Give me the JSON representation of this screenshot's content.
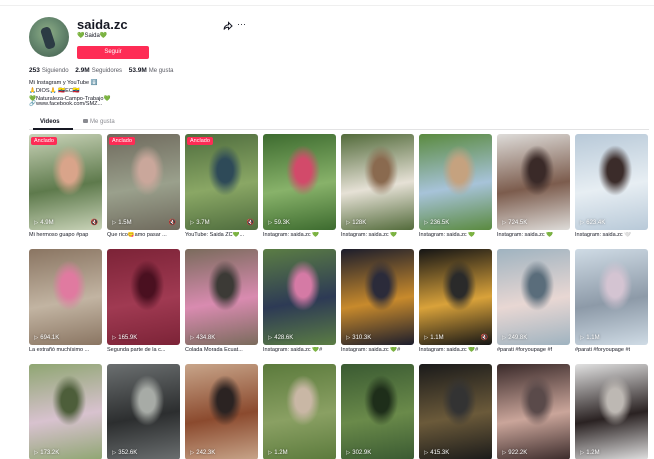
{
  "profile": {
    "username": "saida.zc",
    "nickname": "💚Saida💚",
    "follow_label": "Seguir",
    "share_icon": "share-icon",
    "more_label": "···"
  },
  "stats": {
    "following_count": "253",
    "following_label": "Siguiendo",
    "followers_count": "2.9M",
    "followers_label": "Seguidores",
    "likes_count": "53.9M",
    "likes_label": "Me gusta"
  },
  "bio": {
    "line1": "Mi Instagram y YouTube ⬇️",
    "line2": "🙏DIOS🙏 🇪🇨EC🇪🇨",
    "line3": "💚Naturaleza-Campo-Trabajo💚",
    "link": "www.facebook.com/SMZ..."
  },
  "tabs": {
    "videos": "Videos",
    "likes": "Me gusta"
  },
  "videos": [
    {
      "views": "4.9M",
      "caption": "Mi hermoso guapo #pap",
      "pinned": "Anclado",
      "muted": "🔇",
      "colors": [
        "#c9d3b8",
        "#5e7a4c",
        "#d9a48a"
      ]
    },
    {
      "views": "1.5M",
      "caption": "Que rico😋amo pasar ...",
      "pinned": "Anclado",
      "muted": "🔇",
      "colors": [
        "#6f6a5d",
        "#9aa08c",
        "#caa79b"
      ]
    },
    {
      "views": "3.7M",
      "caption": "YouTube: Saida ZC💚...",
      "pinned": "Anclado",
      "muted": "🔇",
      "colors": [
        "#4f6d3e",
        "#8aa765",
        "#2e4a58"
      ]
    },
    {
      "views": "59.3K",
      "caption": "Instagram: saida.zc 💚",
      "pinned": "",
      "muted": "",
      "colors": [
        "#3d6b2f",
        "#88b26a",
        "#d24a6a"
      ]
    },
    {
      "views": "128K",
      "caption": "Instagram: saida.zc 💚",
      "pinned": "",
      "muted": "",
      "colors": [
        "#536b3b",
        "#e6e1d6",
        "#8a6a4f"
      ]
    },
    {
      "views": "236.5K",
      "caption": "Instagram: saida.zc 💚",
      "pinned": "",
      "muted": "",
      "colors": [
        "#5a8a3f",
        "#a7c3d9",
        "#c5a27f"
      ]
    },
    {
      "views": "724.5K",
      "caption": "Instagram: saida.zc 💚",
      "pinned": "",
      "muted": "",
      "colors": [
        "#dedcd9",
        "#7c5c4d",
        "#3a2a28"
      ]
    },
    {
      "views": "623.4K",
      "caption": "Instagram: saida.zc 🤍",
      "pinned": "",
      "muted": "",
      "colors": [
        "#b8c9d8",
        "#e7eef3",
        "#3b2c2a"
      ]
    },
    {
      "views": "694.1K",
      "caption": "La extrañó muchísimo ...",
      "pinned": "",
      "muted": "",
      "colors": [
        "#8a7562",
        "#c2b4a2",
        "#e07aa0"
      ]
    },
    {
      "views": "165.9K",
      "caption": "Segunda parte de la c...",
      "pinned": "",
      "muted": "",
      "colors": [
        "#7c2337",
        "#a03a52",
        "#4a1020"
      ]
    },
    {
      "views": "434.8K",
      "caption": "Colada Morada Ecuat...",
      "pinned": "",
      "muted": "",
      "colors": [
        "#7a6b5c",
        "#d98bb0",
        "#3c3a36"
      ]
    },
    {
      "views": "428.6K",
      "caption": "Instagram: saida.zc 💚#",
      "pinned": "",
      "muted": "",
      "colors": [
        "#5b7d44",
        "#2d3a55",
        "#d57aa5"
      ]
    },
    {
      "views": "310.3K",
      "caption": "Instagram: saida.zc 💚#",
      "pinned": "",
      "muted": "",
      "colors": [
        "#1c1d2c",
        "#c88a2c",
        "#2b2b3a"
      ]
    },
    {
      "views": "1.1M",
      "caption": "Instagram: saida.zc 💚#",
      "pinned": "",
      "muted": "🔇",
      "colors": [
        "#151515",
        "#d9a23a",
        "#2a2a2a"
      ]
    },
    {
      "views": "249.8K",
      "caption": "#parati #foryoupage #f",
      "pinned": "",
      "muted": "",
      "colors": [
        "#9fb3c0",
        "#e8d7d3",
        "#5a6d7b"
      ]
    },
    {
      "views": "1.1M",
      "caption": "#parati #foryoupage #t",
      "pinned": "",
      "muted": "",
      "colors": [
        "#cfdbe5",
        "#8d9aa8",
        "#d4c4d2"
      ]
    },
    {
      "views": "173.2K",
      "caption": "",
      "pinned": "",
      "muted": "",
      "colors": [
        "#8fa672",
        "#d8c2cf",
        "#4d5e3a"
      ]
    },
    {
      "views": "352.6K",
      "caption": "",
      "pinned": "",
      "muted": "",
      "colors": [
        "#6b6f70",
        "#2c2e2f",
        "#a7aba6"
      ]
    },
    {
      "views": "242.3K",
      "caption": "",
      "pinned": "",
      "muted": "",
      "colors": [
        "#c8a58a",
        "#8b4a2e",
        "#2b2322"
      ]
    },
    {
      "views": "1.2M",
      "caption": "",
      "pinned": "",
      "muted": "",
      "colors": [
        "#5b7a3c",
        "#8aa063",
        "#c9b7a5"
      ]
    },
    {
      "views": "302.9K",
      "caption": "",
      "pinned": "",
      "muted": "",
      "colors": [
        "#3a5a32",
        "#6a8a4a",
        "#1e2e1a"
      ]
    },
    {
      "views": "415.3K",
      "caption": "",
      "pinned": "",
      "muted": "",
      "colors": [
        "#1a1a1a",
        "#6b5a3a",
        "#333333"
      ]
    },
    {
      "views": "922.2K",
      "caption": "",
      "pinned": "",
      "muted": "",
      "colors": [
        "#3a2a2a",
        "#caa59a",
        "#5a4a4a"
      ]
    },
    {
      "views": "1.2M",
      "caption": "",
      "pinned": "",
      "muted": "",
      "colors": [
        "#e1e1e1",
        "#2a2222",
        "#bdb8b3"
      ]
    }
  ]
}
